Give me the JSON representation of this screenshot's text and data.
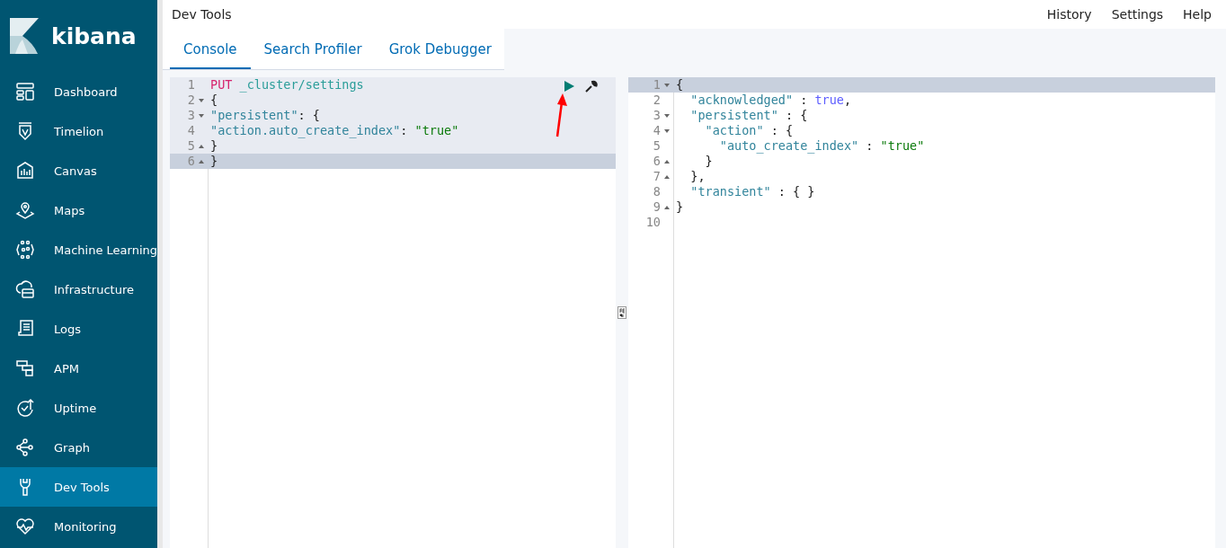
{
  "sidebar": {
    "brand": "kibana",
    "items": [
      {
        "label": "Dashboard",
        "selected": false
      },
      {
        "label": "Timelion",
        "selected": false
      },
      {
        "label": "Canvas",
        "selected": false
      },
      {
        "label": "Maps",
        "selected": false
      },
      {
        "label": "Machine Learning",
        "selected": false
      },
      {
        "label": "Infrastructure",
        "selected": false
      },
      {
        "label": "Logs",
        "selected": false
      },
      {
        "label": "APM",
        "selected": false
      },
      {
        "label": "Uptime",
        "selected": false
      },
      {
        "label": "Graph",
        "selected": false
      },
      {
        "label": "Dev Tools",
        "selected": true
      },
      {
        "label": "Monitoring",
        "selected": false
      }
    ]
  },
  "header": {
    "title": "Dev Tools",
    "links": [
      "History",
      "Settings",
      "Help"
    ]
  },
  "tabs": [
    {
      "label": "Console",
      "selected": true
    },
    {
      "label": "Search Profiler",
      "selected": false
    },
    {
      "label": "Grok Debugger",
      "selected": false
    }
  ],
  "request_editor": {
    "lines": [
      {
        "number": "1",
        "kind": "plain",
        "active": false,
        "tokens": [
          {
            "kind": "method",
            "text": "PUT"
          },
          {
            "kind": "url",
            "text": "_cluster/settings"
          }
        ]
      },
      {
        "number": "2",
        "kind": "opener",
        "active": false,
        "tokens": [
          {
            "kind": "plain",
            "text": "{"
          }
        ]
      },
      {
        "number": "3",
        "kind": "opener",
        "active": false,
        "tokens": [
          {
            "kind": "key",
            "text": "\"persistent\""
          },
          {
            "kind": "plain",
            "text": ": {"
          }
        ]
      },
      {
        "number": "4",
        "kind": "plain",
        "active": false,
        "tokens": [
          {
            "kind": "key",
            "text": "\"action.auto_create_index\""
          },
          {
            "kind": "plain",
            "text": ": "
          },
          {
            "kind": "string",
            "text": "\"true\""
          }
        ]
      },
      {
        "number": "5",
        "kind": "closer",
        "active": false,
        "tokens": [
          {
            "kind": "plain",
            "text": "}"
          }
        ]
      },
      {
        "number": "6",
        "kind": "closer",
        "active": true,
        "tokens": [
          {
            "kind": "plain",
            "text": "}"
          }
        ]
      }
    ]
  },
  "response_editor": {
    "lines": [
      {
        "number": "1",
        "kind": "opener",
        "active": true,
        "tokens": [
          {
            "kind": "plain",
            "text": "{"
          }
        ]
      },
      {
        "number": "2",
        "kind": "plain",
        "active": false,
        "tokens": [
          {
            "kind": "key",
            "text": "  \"acknowledged\""
          },
          {
            "kind": "plain",
            "text": " : "
          },
          {
            "kind": "bool",
            "text": "true"
          },
          {
            "kind": "plain",
            "text": ","
          }
        ]
      },
      {
        "number": "3",
        "kind": "opener",
        "active": false,
        "tokens": [
          {
            "kind": "key",
            "text": "  \"persistent\""
          },
          {
            "kind": "plain",
            "text": " : {"
          }
        ]
      },
      {
        "number": "4",
        "kind": "opener",
        "active": false,
        "tokens": [
          {
            "kind": "key",
            "text": "    \"action\""
          },
          {
            "kind": "plain",
            "text": " : {"
          }
        ]
      },
      {
        "number": "5",
        "kind": "plain",
        "active": false,
        "tokens": [
          {
            "kind": "key",
            "text": "      \"auto_create_index\""
          },
          {
            "kind": "plain",
            "text": " : "
          },
          {
            "kind": "string",
            "text": "\"true\""
          }
        ]
      },
      {
        "number": "6",
        "kind": "closer",
        "active": false,
        "tokens": [
          {
            "kind": "plain",
            "text": "    }"
          }
        ]
      },
      {
        "number": "7",
        "kind": "closer",
        "active": false,
        "tokens": [
          {
            "kind": "plain",
            "text": "  },"
          }
        ]
      },
      {
        "number": "8",
        "kind": "plain",
        "active": false,
        "tokens": [
          {
            "kind": "key",
            "text": "  \"transient\""
          },
          {
            "kind": "plain",
            "text": " : { }"
          }
        ]
      },
      {
        "number": "9",
        "kind": "closer",
        "active": false,
        "tokens": [
          {
            "kind": "plain",
            "text": "}"
          }
        ]
      },
      {
        "number": "10",
        "kind": "plain",
        "active": false
      }
    ]
  }
}
